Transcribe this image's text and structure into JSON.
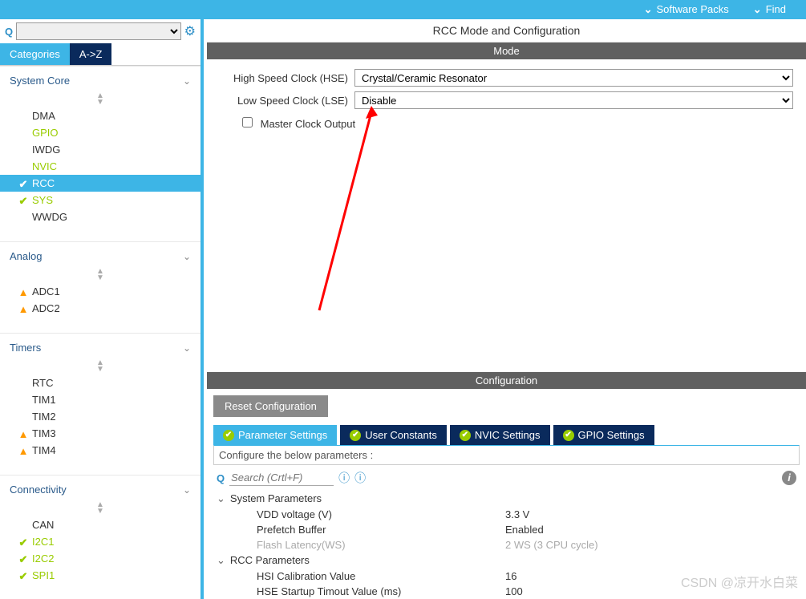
{
  "topbar": {
    "packs": "Software Packs",
    "find": "Find"
  },
  "left": {
    "tabs": {
      "categories": "Categories",
      "az": "A->Z"
    },
    "groups": {
      "systemCore": {
        "label": "System Core",
        "items": [
          "DMA",
          "GPIO",
          "IWDG",
          "NVIC",
          "RCC",
          "SYS",
          "WWDG"
        ]
      },
      "analog": {
        "label": "Analog",
        "items": [
          "ADC1",
          "ADC2"
        ]
      },
      "timers": {
        "label": "Timers",
        "items": [
          "RTC",
          "TIM1",
          "TIM2",
          "TIM3",
          "TIM4"
        ]
      },
      "connectivity": {
        "label": "Connectivity",
        "items": [
          "CAN",
          "I2C1",
          "I2C2",
          "SPI1"
        ]
      }
    }
  },
  "right": {
    "title": "RCC Mode and Configuration",
    "modeLabel": "Mode",
    "hseLabel": "High Speed Clock (HSE)",
    "hseValue": "Crystal/Ceramic Resonator",
    "lseLabel": "Low Speed Clock (LSE)",
    "lseValue": "Disable",
    "mcoLabel": "Master Clock Output",
    "configLabel": "Configuration",
    "resetBtn": "Reset Configuration",
    "subTabs": {
      "param": "Parameter Settings",
      "user": "User Constants",
      "nvic": "NVIC Settings",
      "gpio": "GPIO Settings"
    },
    "desc": "Configure the below parameters :",
    "searchPlaceholder": "Search (Crtl+F)",
    "params": {
      "g1": "System Parameters",
      "vddK": "VDD voltage (V)",
      "vddV": "3.3 V",
      "pfK": "Prefetch Buffer",
      "pfV": "Enabled",
      "flK": "Flash Latency(WS)",
      "flV": "2 WS (3 CPU cycle)",
      "g2": "RCC Parameters",
      "hsiK": "HSI Calibration Value",
      "hsiV": "16",
      "hseK": "HSE Startup Timout Value (ms)",
      "hseV": "100"
    }
  },
  "watermark": "CSDN @凉开水白菜"
}
